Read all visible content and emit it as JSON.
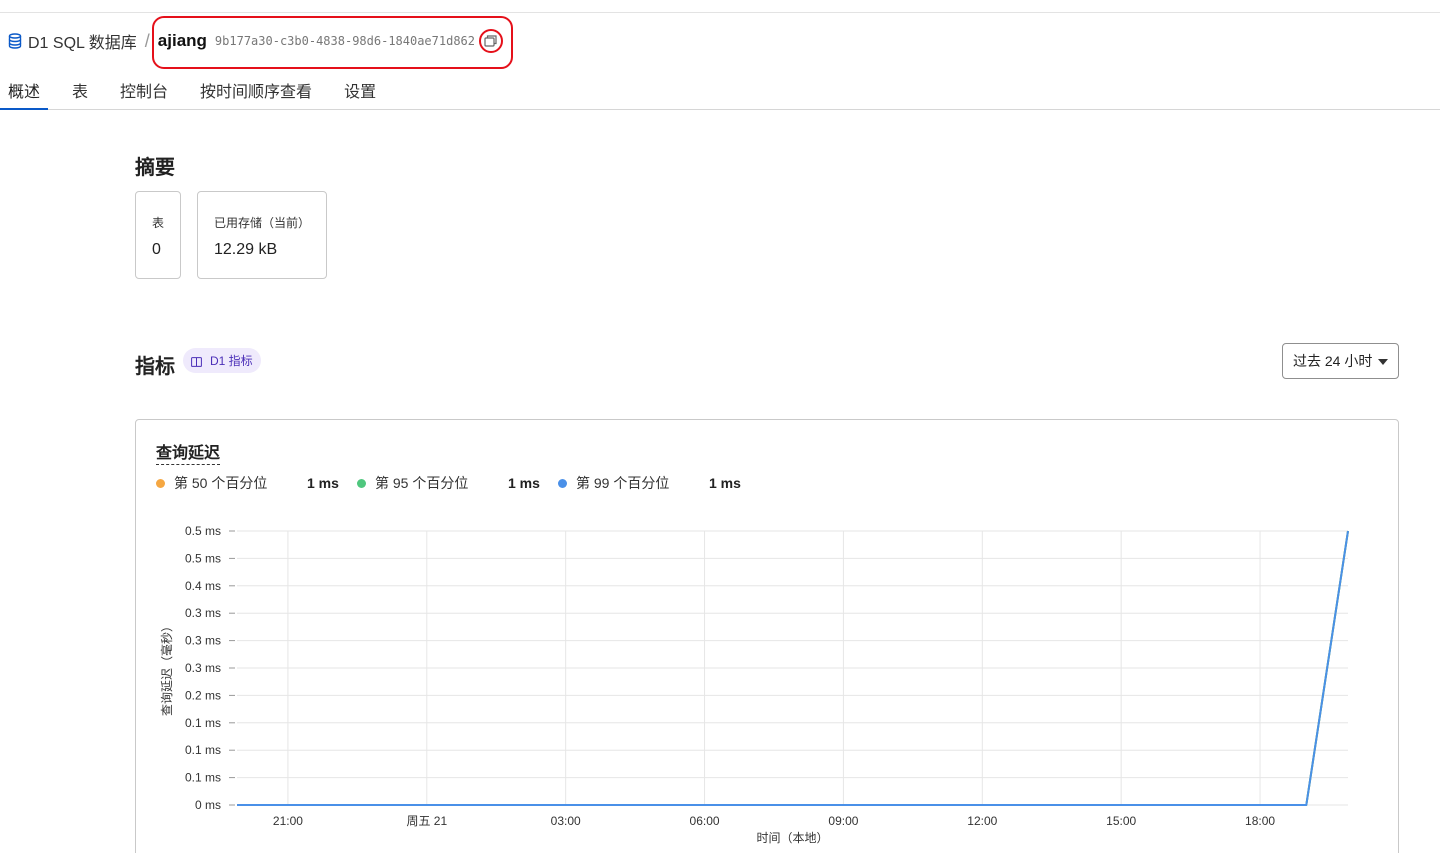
{
  "breadcrumb": {
    "parent": "D1 SQL 数据库",
    "db_name": "ajiang",
    "db_id": "9b177a30-c3b0-4838-98d6-1840ae71d862"
  },
  "tabs": [
    {
      "label": "概述",
      "active": true
    },
    {
      "label": "表",
      "active": false
    },
    {
      "label": "控制台",
      "active": false
    },
    {
      "label": "按时间顺序查看",
      "active": false
    },
    {
      "label": "设置",
      "active": false
    }
  ],
  "summary": {
    "title": "摘要",
    "cards": [
      {
        "label": "表",
        "value": "0"
      },
      {
        "label": "已用存储（当前）",
        "value": "12.29 kB"
      }
    ]
  },
  "metrics": {
    "title": "指标",
    "badge": "D1 指标",
    "range_select": "过去 24 小时"
  },
  "colors": {
    "accent": "#0a59c8",
    "highlight": "#e5101a",
    "p50": "#f5a742",
    "p95": "#4fc77e",
    "p99": "#4a90e8"
  },
  "chart_data": {
    "type": "line",
    "title": "查询延迟",
    "xlabel": "时间（本地）",
    "ylabel": "查询延迟（毫秒）",
    "x_tick_labels": [
      "21:00",
      "周五 21",
      "03:00",
      "06:00",
      "09:00",
      "12:00",
      "15:00",
      "18:00"
    ],
    "y_tick_labels": [
      "0 ms",
      "0.1 ms",
      "0.1 ms",
      "0.1 ms",
      "0.2 ms",
      "0.3 ms",
      "0.3 ms",
      "0.3 ms",
      "0.4 ms",
      "0.5 ms",
      "0.5 ms"
    ],
    "ylim": [
      0,
      0.5
    ],
    "xlim_hours": [
      19.9,
      43.9
    ],
    "x_tick_hours": [
      21,
      24,
      27,
      30,
      33,
      36,
      39,
      42
    ],
    "grid": true,
    "series": [
      {
        "name": "第 50 个百分位",
        "summary": "1 ms",
        "color": "#f5a742",
        "x_hours": [
          19.9,
          43.0,
          43.9
        ],
        "values": [
          0,
          0,
          0.5
        ]
      },
      {
        "name": "第 95 个百分位",
        "summary": "1 ms",
        "color": "#4fc77e",
        "x_hours": [
          19.9,
          43.0,
          43.9
        ],
        "values": [
          0,
          0,
          0.5
        ]
      },
      {
        "name": "第 99 个百分位",
        "summary": "1 ms",
        "color": "#4a90e8",
        "x_hours": [
          19.9,
          43.0,
          43.9
        ],
        "values": [
          0,
          0,
          0.5
        ]
      }
    ]
  }
}
